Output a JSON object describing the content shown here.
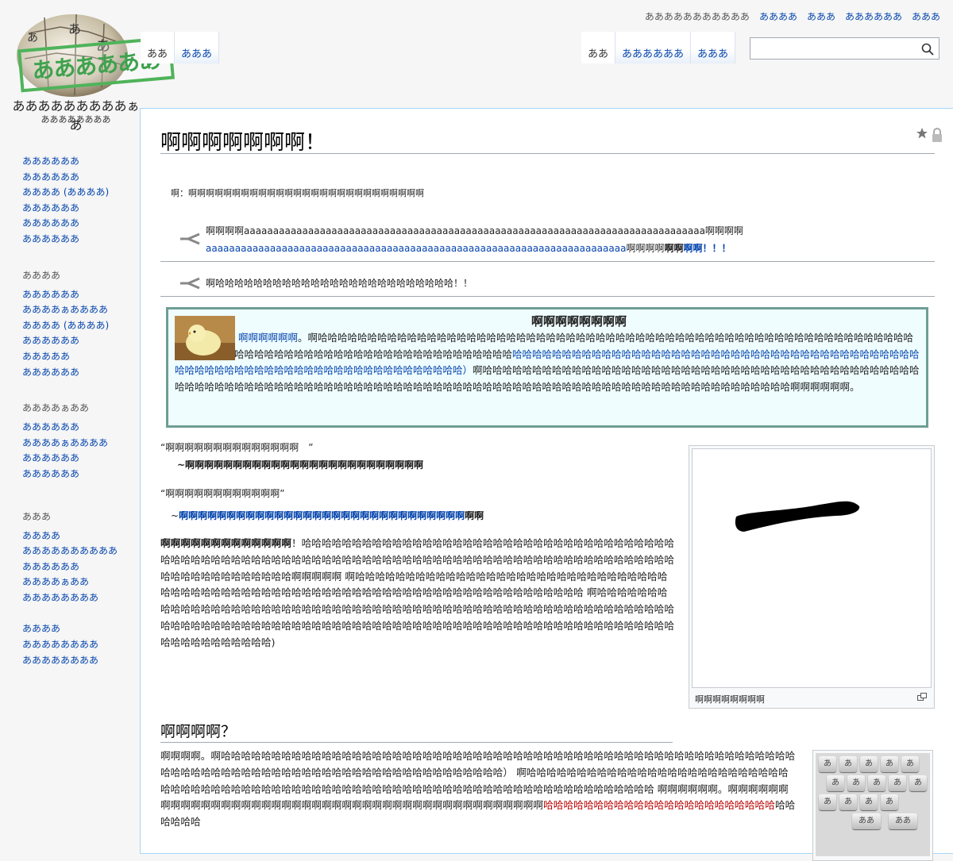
{
  "site": {
    "logo_stamp": "ああああああ",
    "name": "あああああああああぁあ",
    "tagline": "ああああああああ"
  },
  "personal": [
    "あああああああああああ",
    "ああああ",
    "あああ",
    "ああああああ",
    "あああ"
  ],
  "left_tabs": [
    {
      "label": "ああ",
      "selected": true
    },
    {
      "label": "あああ",
      "selected": false
    }
  ],
  "right_tabs": [
    {
      "label": "ああ",
      "selected": true
    },
    {
      "label": "ああああああ",
      "selected": false
    },
    {
      "label": "あああ",
      "selected": false
    }
  ],
  "search": {
    "placeholder": ""
  },
  "sidebar": [
    {
      "heading": "",
      "items": [
        "ああああああ",
        "ああああああ",
        "ああああ (ああああ)",
        "ああああああ",
        "ああああああ",
        "ああああああ"
      ]
    },
    {
      "heading": "ああああ",
      "items": [
        "ああああああ",
        "ああああぁああああ",
        "ああああ (ああああ)",
        "ああああああ",
        "あああああ",
        "ああああああ"
      ]
    },
    {
      "heading": "ああああぁああ",
      "items": [
        "ああああああ",
        "ああああぁああああ",
        "ああああああ",
        "ああああああ"
      ]
    },
    {
      "heading": "あああ",
      "items": [
        "ああああ",
        "ああああああああああ",
        "ああああああ",
        "ああああぁああ",
        "ああああああああ"
      ]
    },
    {
      "heading": "",
      "items": [
        "ああああ",
        "ああああああああ",
        "ああああああああ"
      ]
    }
  ],
  "article": {
    "title": "啊啊啊啊啊啊啊！",
    "hatnote": "啊：啊啊啊啊啊啊啊啊啊啊啊啊啊啊啊啊啊啊啊啊啊啊啊啊啊啊啊",
    "dab1_a": "啊啊啊啊aaaaaaaaaaaaaaaaaaaaaaaaaaaaaaaaaaaaaaaaaaaaaaaaaaaaaaaaaaaaaaaaaaaaaaaaaaaaaaa啊啊啊啊",
    "dab1_b_link": "aaaaaaaaaaaaaaaaaaaaaaaaaaaaaaaaaaaaaaaaaaaaaaaaaaaaaaaaaaaaaaaaaaaaaaaa",
    "dab1_c": "啊啊啊啊",
    "dab1_d_bold": "啊啊",
    "dab1_e_link": "啊啊！！！",
    "dab2": "啊哈哈哈哈哈哈哈哈哈哈哈哈哈哈哈哈哈哈哈哈哈哈哈哈哈！！",
    "notice_title": "啊啊啊啊啊啊啊啊",
    "notice_link1": "啊啊啊啊啊啊",
    "notice_text1": "。啊哈哈哈哈哈哈哈哈哈哈哈哈哈哈哈哈哈哈哈哈哈哈哈哈哈哈哈哈哈哈哈哈哈哈哈哈哈哈哈哈哈哈哈哈哈哈哈哈哈哈哈哈哈哈哈哈哈哈哈哈哈哈哈哈哈哈哈哈哈哈哈哈哈哈哈哈哈哈哈哈哈哈哈哈哈哈哈哈哈哈哈哈哈哈",
    "notice_link2": "哈哈哈哈哈哈哈哈哈哈哈哈哈哈哈哈哈哈哈哈哈哈哈哈哈哈哈哈哈哈哈哈哈哈哈哈哈哈哈哈哈哈哈哈哈哈哈哈哈哈哈哈哈哈哈哈哈哈哈哈哈哈哈哈哈哈哈哈哈哈）",
    "notice_text2": "啊哈哈哈哈哈哈哈哈哈哈哈哈哈哈哈哈哈哈哈哈哈哈哈哈哈哈哈哈哈哈哈哈哈哈哈哈哈哈哈哈哈哈哈哈哈哈哈哈哈哈哈哈哈哈哈哈哈哈哈哈哈哈哈哈哈哈哈哈哈哈哈哈哈哈哈哈哈哈哈哈哈哈哈哈哈哈哈哈哈哈哈哈哈哈哈哈哈哈哈哈哈哈哈哈哈哈啊啊啊啊啊啊。",
    "quote1": "“啊啊啊啊啊啊啊啊啊啊啊啊啊啊　”",
    "quote1_attr": "~啊啊啊啊啊啊啊啊啊啊啊啊啊啊啊啊啊啊啊啊啊啊啊啊啊",
    "quote2": "“啊啊啊啊啊啊啊啊啊啊啊啊”",
    "quote2_attr_link": "啊啊啊啊啊啊啊啊啊啊啊啊啊啊啊啊啊啊啊啊啊啊啊啊啊啊啊啊啊啊",
    "quote2_attr_tail": "啊啊",
    "para1_bold": "啊啊啊啊啊啊啊啊啊啊啊啊啊",
    "para1": "！哈哈哈哈哈哈哈哈哈哈哈哈哈哈哈哈哈哈哈哈哈哈哈哈哈哈哈哈哈哈哈哈哈哈哈哈哈哈哈哈哈哈哈哈哈哈哈哈哈哈哈哈哈哈哈哈哈哈哈哈哈哈哈哈哈哈哈哈哈哈哈哈哈哈哈哈哈哈哈哈哈哈哈哈哈哈哈哈哈哈哈哈哈哈哈哈哈哈哈哈哈啊啊啊啊啊 啊哈哈哈哈哈哈哈哈哈哈哈哈哈哈哈哈哈哈哈哈哈哈哈哈哈哈哈哈哈哈哈哈哈哈哈哈哈哈哈哈哈哈哈哈哈哈哈哈哈哈哈哈哈哈哈哈哈哈哈哈哈哈哈哈哈哈哈哈哈哈哈哈哈 啊哈哈哈哈哈哈哈哈哈哈哈哈哈哈哈哈哈哈哈哈哈哈哈哈哈哈哈哈哈哈哈哈哈哈哈哈哈哈哈哈哈哈哈哈哈哈哈哈哈哈哈哈哈哈哈哈哈哈哈哈哈哈哈哈哈哈哈哈哈哈哈哈哈哈哈哈哈哈哈哈哈哈哈哈哈哈哈哈哈哈哈哈哈哈哈哈哈哈哈哈哈哈哈哈哈哈哈哈哈哈哈哈哈哈哈哈哈哈哈哈)",
    "thumb1_caption": "啊啊啊啊啊啊啊啊",
    "section_heading": "啊啊啊啊？",
    "para2": "啊啊啊啊。啊哈哈哈哈哈哈哈哈哈哈哈哈哈哈哈哈哈哈哈哈哈哈哈哈哈哈哈哈哈哈哈哈哈哈哈哈哈哈哈哈哈哈哈哈哈哈哈哈哈哈哈哈哈哈哈哈哈哈哈哈哈哈哈哈哈哈哈哈哈哈哈哈哈哈哈哈哈哈哈哈哈哈哈哈哈哈哈哈哈哈哈） 啊哈哈哈哈哈哈哈哈哈哈哈哈哈哈哈哈哈哈哈哈哈哈哈哈哈哈哈哈哈哈哈哈哈哈哈哈哈哈哈哈哈哈哈哈哈哈哈哈哈哈哈哈哈哈哈哈哈哈哈哈哈哈哈哈哈哈哈哈哈哈哈哈哈哈哈 啊啊啊啊啊啊。啊啊啊啊啊啊啊啊啊啊啊啊啊啊啊啊啊啊啊啊啊啊啊啊啊啊啊啊啊啊啊啊啊啊啊啊啊啊啊啊啊啊啊啊",
    "para2_red": "哈哈哈哈哈哈哈哈哈哈哈哈哈哈哈哈哈哈哈哈哈哈哈",
    "para2_tail": "哈哈哈哈哈哈",
    "keyboard_keys": [
      "あ",
      "あ",
      "あ",
      "あ",
      "あ",
      "あ",
      "あ",
      "あ",
      "あ",
      "あ",
      "あ",
      "あ",
      "あ",
      "あ",
      "ああ",
      "ああ"
    ]
  },
  "colors": {
    "link": "#0645ad",
    "notice_bg": "#effdff",
    "notice_border": "#6e9e94",
    "stamp": "#4fb35a"
  }
}
